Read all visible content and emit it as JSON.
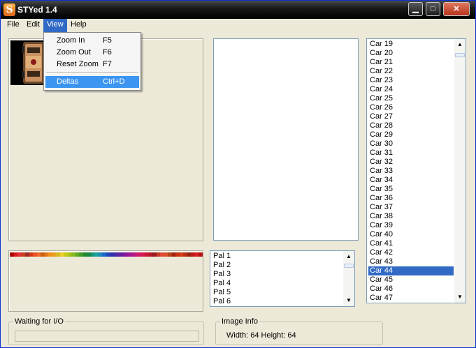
{
  "window": {
    "title": "STYed 1.4",
    "icon_letter": "S",
    "controls": {
      "minimize": "▁",
      "maximize": "□",
      "close": "✕"
    }
  },
  "menubar": {
    "items": [
      "File",
      "Edit",
      "View",
      "Help"
    ],
    "active": "View"
  },
  "view_menu": {
    "items": [
      {
        "label": "Zoom In",
        "shortcut": "F5"
      },
      {
        "label": "Zoom Out",
        "shortcut": "F6"
      },
      {
        "label": "Reset Zoom",
        "shortcut": "F7"
      },
      {
        "label": "Deltas",
        "shortcut": "Ctrl+D",
        "highlighted": true
      }
    ]
  },
  "palette_list": {
    "items": [
      "Pal 1",
      "Pal 2",
      "Pal 3",
      "Pal 4",
      "Pal 5",
      "Pal 6"
    ]
  },
  "sprite_list": {
    "items": [
      "Car 19",
      "Car 20",
      "Car 21",
      "Car 22",
      "Car 23",
      "Car 24",
      "Car 25",
      "Car 26",
      "Car 27",
      "Car 28",
      "Car 29",
      "Car 30",
      "Car 31",
      "Car 32",
      "Car 33",
      "Car 34",
      "Car 35",
      "Car 36",
      "Car 37",
      "Car 38",
      "Car 39",
      "Car 40",
      "Car 41",
      "Car 42",
      "Car 43",
      "Car 44",
      "Car 45",
      "Car 46",
      "Car 47"
    ],
    "selected": "Car 44"
  },
  "status": {
    "legend": "Waiting for I/O",
    "progress": 0
  },
  "image_info": {
    "legend": "Image Info",
    "text": "Width: 64 Height: 64"
  },
  "colors": {
    "selection": "#316ac5",
    "menu_highlight": "#3d95f2",
    "palette": [
      "#b00000",
      "#d81818",
      "#e03030",
      "#c84020",
      "#a02828",
      "#d83818",
      "#e85020",
      "#f06828",
      "#c86010",
      "#e07818",
      "#f09018",
      "#e8a020",
      "#d8b820",
      "#e8d028",
      "#c8c818",
      "#a8c018",
      "#88b820",
      "#60a820",
      "#409828",
      "#208828",
      "#18884a",
      "#18987a",
      "#18a0a0",
      "#1888b8",
      "#1868c8",
      "#2048c0",
      "#3030b0",
      "#4828a8",
      "#6020a0",
      "#7818a0",
      "#901898",
      "#a81890",
      "#c01880",
      "#d01868",
      "#d81850",
      "#c81838",
      "#b01828",
      "#981820",
      "#c83828",
      "#e04838",
      "#d85028",
      "#b84018",
      "#a02010",
      "#c83010",
      "#d84018",
      "#b83010",
      "#982010",
      "#c01818",
      "#d82020",
      "#b81010"
    ]
  }
}
